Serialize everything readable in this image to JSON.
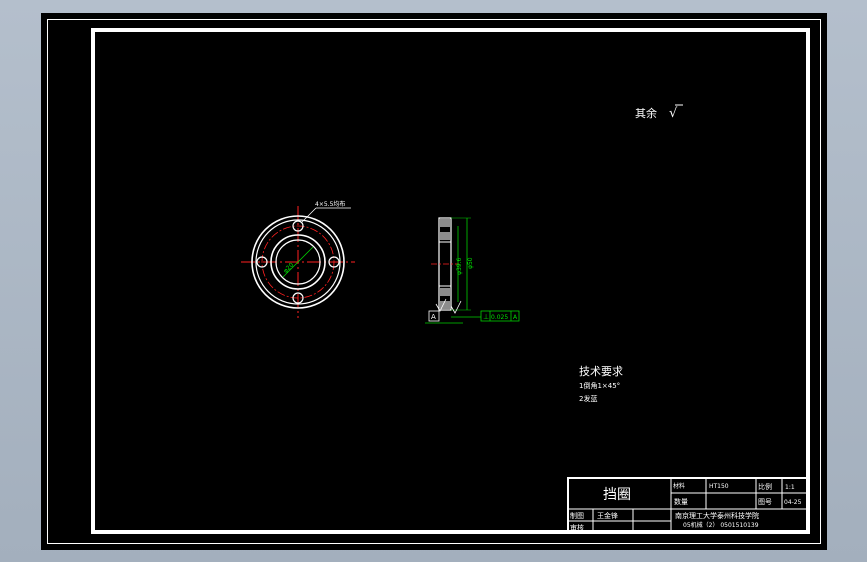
{
  "drawing": {
    "roughness_note": "其余",
    "roughness_symbol": "√",
    "hole_callout": "4×5.5均布",
    "dia_inner_label": "φ20",
    "dia_bolt_label": "φ39.6",
    "dia_outer_label": "φ50",
    "tolerance_frame": {
      "symbol": "⊥",
      "value": "0.025",
      "datum": "A"
    },
    "datum_letter": "A"
  },
  "technical_requirements": {
    "title": "技术要求",
    "items": [
      "1倒角1×45°",
      "2发蓝"
    ]
  },
  "title_block": {
    "part_name": "挡圈",
    "material_label": "材料",
    "material_value": "HT150",
    "scale_label": "比例",
    "scale_value": "1:1",
    "qty_label": "数量",
    "drawing_no_label": "图号",
    "drawing_no_value": "04-25",
    "drafter_label": "制图",
    "drafter_name": "王金锋",
    "checker_label": "审核",
    "school": "南京理工大学泰州科技学院",
    "class_info": "05机械（2）  0501510139"
  }
}
